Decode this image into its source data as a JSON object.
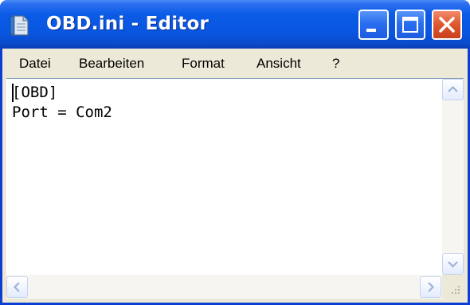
{
  "window": {
    "title": "OBD.ini - Editor"
  },
  "menu": {
    "items": [
      "Datei",
      "Bearbeiten",
      "Format",
      "Ansicht",
      "?"
    ]
  },
  "editor": {
    "content": "[OBD]\nPort = Com2"
  },
  "icons": {
    "app": "notepad-icon",
    "minimize": "minimize-icon",
    "maximize": "maximize-icon",
    "close": "close-icon",
    "scroll_up": "arrow-up-icon",
    "scroll_down": "arrow-down-icon",
    "scroll_left": "arrow-left-icon",
    "scroll_right": "arrow-right-icon",
    "resize_grip": "resize-grip-icon"
  },
  "colors": {
    "titlebar": "#0a5be6",
    "close_button": "#e05a32",
    "chrome": "#ece9d8",
    "editor_background": "#ffffff"
  }
}
